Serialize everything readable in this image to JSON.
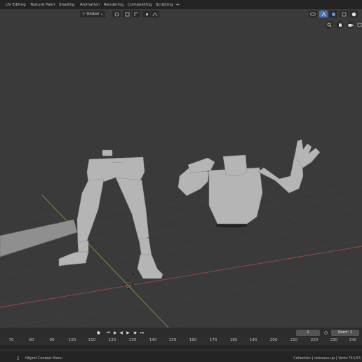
{
  "workspace_tabs": [
    "UV Editing",
    "Texture Paint",
    "Shading",
    "Animation",
    "Rendering",
    "Compositing",
    "Scripting"
  ],
  "add_tab": "+",
  "viewport_header": {
    "orientation": "Global",
    "icons": [
      "transform-orientation-icon",
      "pivot-icon",
      "snap-icon",
      "proportional-edit-icon"
    ]
  },
  "overlay_icons": [
    "visibility-icon",
    "gizmo-icon",
    "overlay-icon",
    "xray-icon",
    "shading-solid-icon",
    "shading-material-icon"
  ],
  "nav_gizmos": [
    "zoom-icon",
    "hand-pan-icon",
    "camera-view-icon",
    "ortho-grid-icon"
  ],
  "scene": {
    "objects": [
      "legs-mesh",
      "torso-mesh",
      "ground-plane"
    ],
    "colors": {
      "background": "#3a3a3a",
      "mesh": "#b5b5b5",
      "x_axis": "#9c4a4a",
      "y_axis": "#7c9a33"
    }
  },
  "timeline": {
    "current_frame": "1",
    "start_label": "Start:",
    "start_value": "1",
    "ticks": [
      "70",
      "80",
      "90",
      "100",
      "110",
      "120",
      "130",
      "140",
      "150",
      "160",
      "170",
      "180",
      "190",
      "200",
      "210",
      "220",
      "230",
      "240"
    ]
  },
  "status": {
    "context_menu": "Object Context Menu",
    "info": "Collection | colossus-up | Verts:743,53"
  }
}
